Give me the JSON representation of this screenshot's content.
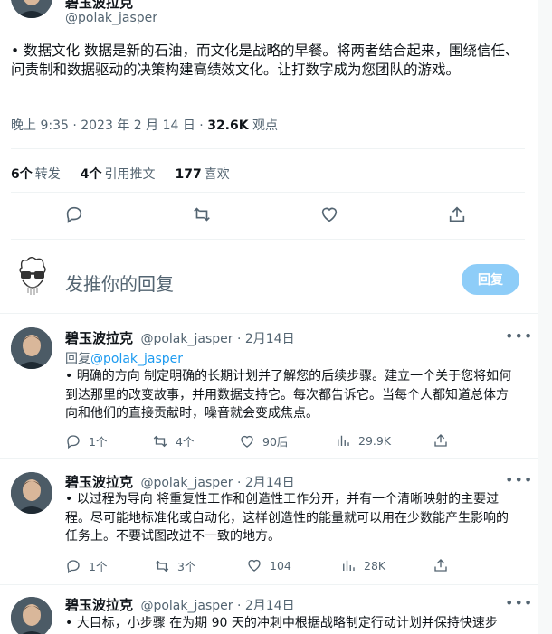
{
  "main_tweet": {
    "author_name": "碧玉波拉克",
    "author_handle": "@polak_jasper",
    "text": "• 数据文化 数据是新的石油，而文化是战略的早餐。将两者结合起来，围绕信任、问责制和数据驱动的决策构建高绩效文化。让打数字成为您团队的游戏。",
    "timestamp": "晚上 9:35 · 2023 年 2 月 14 日 · ",
    "views_count": "32.6K",
    "views_label": " 观点",
    "retweets_count": "6个",
    "retweets_label": "转发",
    "quotes_count": "4个",
    "quotes_label": "引用推文",
    "likes_count": "177",
    "likes_label": "喜欢",
    "action_icons": [
      "reply-icon",
      "retweet-icon",
      "like-icon",
      "share-icon"
    ]
  },
  "composer": {
    "placeholder": "发推你的回复",
    "button_label": "回复",
    "button_color": "#8ecdf8"
  },
  "replies": [
    {
      "author_name": "碧玉波拉克",
      "author_handle": "@polak_jasper",
      "date": "· 2月14日",
      "reply_to_label": "回复",
      "reply_to_handle": "@polak_jasper",
      "text": "• 明确的方向 制定明确的长期计划并了解您的后续步骤。建立一个关于您将如何到达那里的改变故事，并用数据支持它。每次都告诉它。当每个人都知道总体方向和他们的直接贡献时，噪音就会变成焦点。",
      "replies": "1个",
      "retweets": "4个",
      "likes": "90后",
      "views": "29.9K"
    },
    {
      "author_name": "碧玉波拉克",
      "author_handle": "@polak_jasper",
      "date": "· 2月14日",
      "text": "• 以过程为导向 将重复性工作和创造性工作分开，并有一个清晰映射的主要过程。尽可能地标准化或自动化，这样创造性的能量就可以用在少数能产生影响的任务上。不要试图改进不一致的地方。",
      "replies": "1个",
      "retweets": "3个",
      "likes": "104",
      "views": "28K"
    },
    {
      "author_name": "碧玉波拉克",
      "author_handle": "@polak_jasper",
      "date": "· 2月14日",
      "text": "• 大目标，小步骤 在为期 90 天的冲刺中根据战略制定行动计划并保持快速步"
    }
  ],
  "more_label": "•••",
  "accent_color": "#1d9bf0"
}
